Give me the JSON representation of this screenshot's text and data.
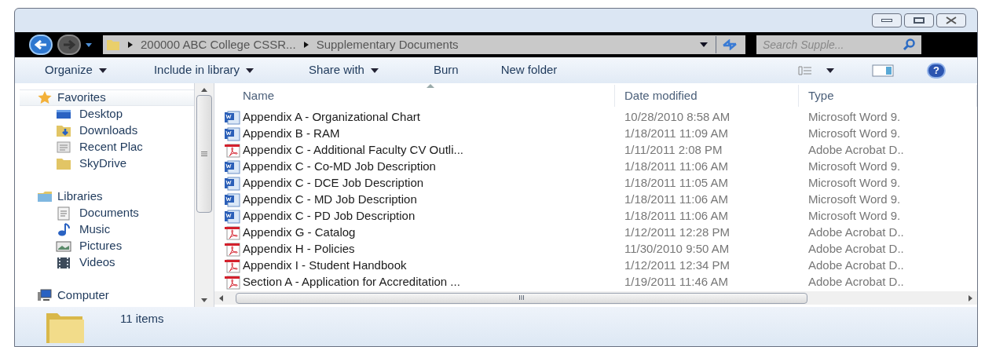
{
  "address_bar": {
    "crumbs": [
      "200000 ABC College CSSR...",
      "Supplementary Documents"
    ]
  },
  "search": {
    "placeholder": "Search Supple..."
  },
  "toolbar": {
    "buttons": [
      {
        "label": "Organize",
        "dropdown": true
      },
      {
        "label": "Include in library",
        "dropdown": true
      },
      {
        "label": "Share with",
        "dropdown": true
      },
      {
        "label": "Burn",
        "dropdown": false
      },
      {
        "label": "New folder",
        "dropdown": false
      }
    ]
  },
  "sidebar": {
    "groups": [
      {
        "label": "Favorites",
        "children": [
          {
            "label": "Desktop"
          },
          {
            "label": "Downloads"
          },
          {
            "label": "Recent Plac"
          },
          {
            "label": "SkyDrive"
          }
        ]
      },
      {
        "label": "Libraries",
        "children": [
          {
            "label": "Documents"
          },
          {
            "label": "Music"
          },
          {
            "label": "Pictures"
          },
          {
            "label": "Videos"
          }
        ]
      },
      {
        "label": "Computer"
      }
    ]
  },
  "help_button": {
    "label": "?"
  },
  "table": {
    "columns": [
      "Name",
      "Date modified",
      "Type"
    ],
    "rows": [
      {
        "kind": "word",
        "name": "Appendix A - Organizational Chart",
        "date": "10/28/2010 8:58 AM",
        "type": "Microsoft Word 9."
      },
      {
        "kind": "word",
        "name": "Appendix B - RAM",
        "date": "1/18/2011 11:09 AM",
        "type": "Microsoft Word 9."
      },
      {
        "kind": "pdf",
        "name": "Appendix C - Additional Faculty CV Outli...",
        "date": "1/11/2011 2:08 PM",
        "type": "Adobe Acrobat D.."
      },
      {
        "kind": "word",
        "name": "Appendix C - Co-MD Job Description",
        "date": "1/18/2011 11:06 AM",
        "type": "Microsoft Word 9."
      },
      {
        "kind": "word",
        "name": "Appendix C - DCE Job Description",
        "date": "1/18/2011 11:05 AM",
        "type": "Microsoft Word 9."
      },
      {
        "kind": "word",
        "name": "Appendix C - MD Job Description",
        "date": "1/18/2011 11:06 AM",
        "type": "Microsoft Word 9."
      },
      {
        "kind": "word",
        "name": "Appendix C - PD Job Description",
        "date": "1/18/2011 11:06 AM",
        "type": "Microsoft Word 9."
      },
      {
        "kind": "pdf",
        "name": "Appendix G - Catalog",
        "date": "1/12/2011 12:28 PM",
        "type": "Adobe Acrobat D.."
      },
      {
        "kind": "pdf",
        "name": "Appendix H - Policies",
        "date": "11/30/2010 9:50 AM",
        "type": "Adobe Acrobat D.."
      },
      {
        "kind": "pdf",
        "name": "Appendix I - Student Handbook",
        "date": "1/12/2011 12:34 PM",
        "type": "Adobe Acrobat D.."
      },
      {
        "kind": "pdf",
        "name": "Section A - Application for Accreditation ...",
        "date": "1/19/2011 11:46 AM",
        "type": "Adobe Acrobat D.."
      }
    ]
  },
  "scrollbar_label": "III",
  "status_bar": {
    "count": "11 items"
  }
}
